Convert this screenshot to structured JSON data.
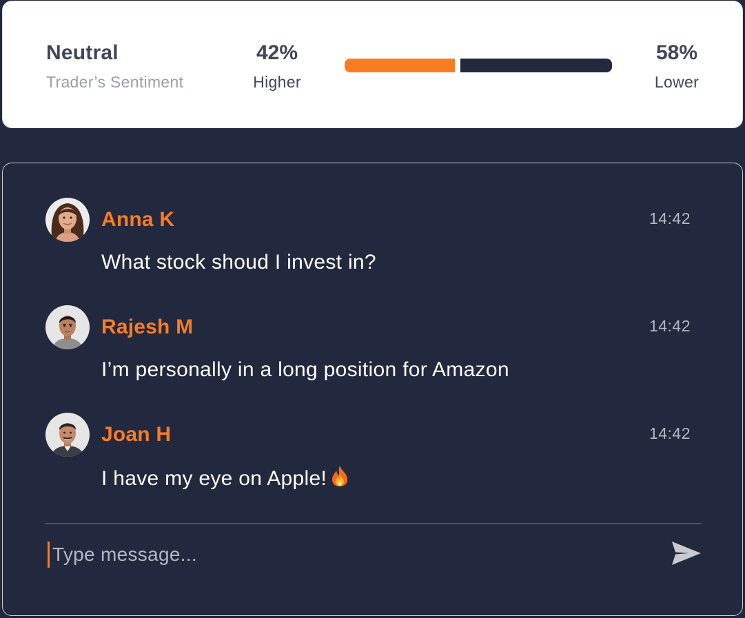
{
  "sentiment": {
    "title": "Neutral",
    "subtitle": "Trader’s Sentiment",
    "higher": {
      "value": "42%",
      "label": "Higher",
      "fraction": 0.42
    },
    "lower": {
      "value": "58%",
      "label": "Lower",
      "fraction": 0.58
    }
  },
  "chat": {
    "messages": [
      {
        "author": "Anna K",
        "time": "14:42",
        "text": "What stock shoud I invest in?",
        "avatar": "woman-avatar"
      },
      {
        "author": "Rajesh M",
        "time": "14:42",
        "text": "I’m personally in a long position for Amazon",
        "avatar": "man-avatar"
      },
      {
        "author": "Joan H",
        "time": "14:42",
        "text": "I have my eye on Apple!",
        "emoji": "fire-icon",
        "avatar": "man-avatar"
      }
    ],
    "composer": {
      "placeholder": "Type message..."
    }
  },
  "colors": {
    "accent": "#fa7c22",
    "background": "#22283d",
    "card": "#ffffff",
    "muted_text": "#b4b8c2"
  }
}
